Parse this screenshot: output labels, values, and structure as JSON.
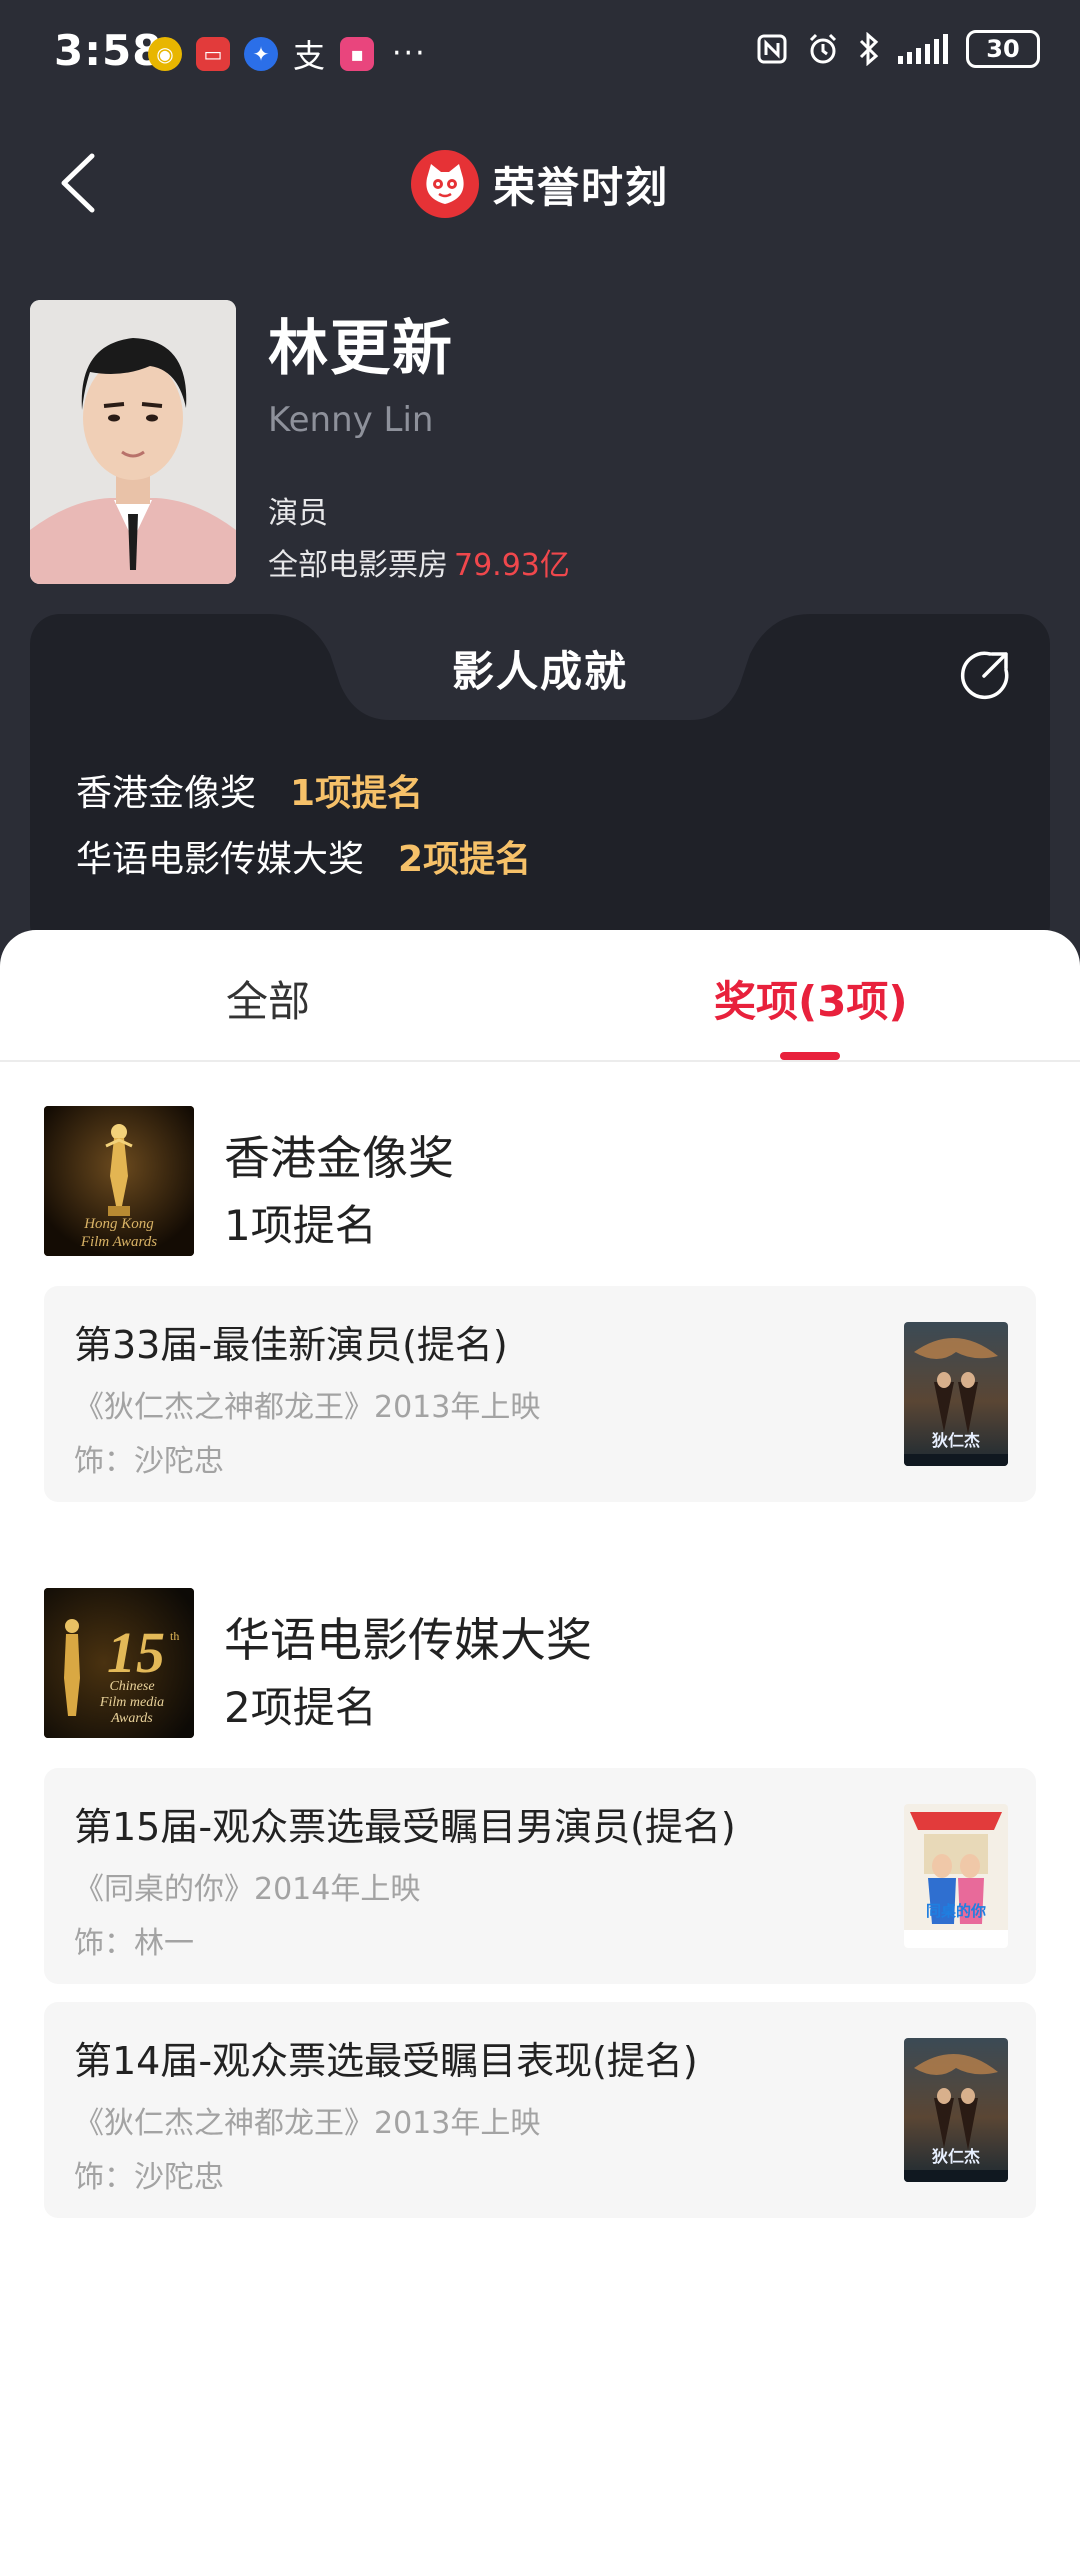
{
  "status_bar": {
    "time": "3:58",
    "more": "···",
    "battery": "30"
  },
  "header": {
    "title": "荣誉时刻"
  },
  "profile": {
    "name": "林更新",
    "english_name": "Kenny Lin",
    "role": "演员",
    "box_office_label": "全部电影票房",
    "box_office_value": "79.93亿"
  },
  "achievements": {
    "title": "影人成就",
    "items": [
      {
        "award": "香港金像奖",
        "count": "1项提名"
      },
      {
        "award": "华语电影传媒大奖",
        "count": "2项提名"
      }
    ]
  },
  "tabs": {
    "all": "全部",
    "awards": "奖项(3项)"
  },
  "award_groups": [
    {
      "name": "香港金像奖",
      "count": "1项提名",
      "logo_text": "Hong Kong Film Awards",
      "nominations": [
        {
          "title": "第33届-最佳新演员(提名)",
          "film": "《狄仁杰之神都龙王》2013年上映",
          "role": "饰：沙陀忠"
        }
      ]
    },
    {
      "name": "华语电影传媒大奖",
      "count": "2项提名",
      "logo_text": "15th Chinese Film Media Awards",
      "nominations": [
        {
          "title": "第15届-观众票选最受瞩目男演员(提名)",
          "film": "《同桌的你》2014年上映",
          "role": "饰：林一"
        },
        {
          "title": "第14届-观众票选最受瞩目表现(提名)",
          "film": "《狄仁杰之神都龙王》2013年上映",
          "role": "饰：沙陀忠"
        }
      ]
    }
  ],
  "colors": {
    "background": "#2b2d36",
    "panel": "#1f2128",
    "accent_red": "#e8213c",
    "box_office_red": "#f0474c",
    "gold": "#f6c169"
  },
  "icons": [
    "back-arrow-icon",
    "maoyan-cat-logo",
    "share-icon",
    "nfc-icon",
    "alarm-icon",
    "bluetooth-icon",
    "signal-icon",
    "battery-icon"
  ]
}
